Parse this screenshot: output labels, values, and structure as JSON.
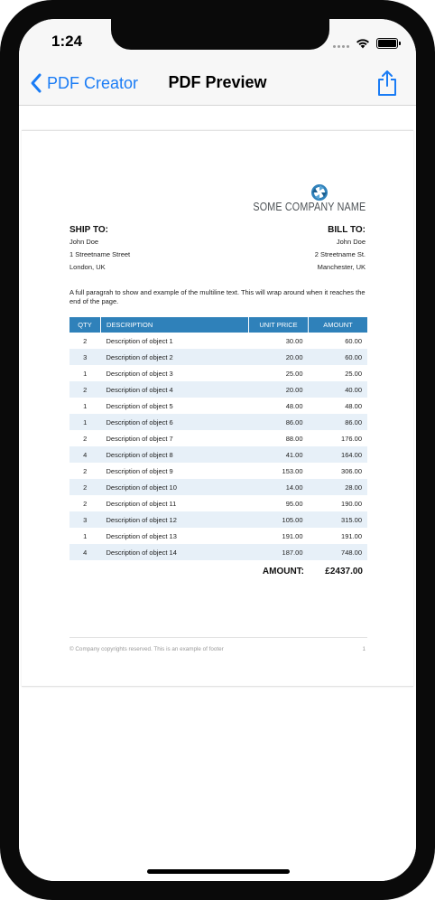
{
  "status_bar": {
    "time": "1:24"
  },
  "nav": {
    "back_label": "PDF Creator",
    "title": "PDF Preview",
    "share_icon": "share-icon"
  },
  "document": {
    "company_name": "SOME COMPANY NAME",
    "ship_to": {
      "heading": "SHIP TO:",
      "lines": [
        "John Doe",
        "1 Streetname Street",
        "London, UK"
      ]
    },
    "bill_to": {
      "heading": "BILL TO:",
      "lines": [
        "John Doe",
        "2 Streetname St.",
        "Manchester, UK"
      ]
    },
    "paragraph": "A full paragrah to show and example of the multiline text. This will wrap around when it reaches the end of the page.",
    "table": {
      "headers": [
        "QTY",
        "DESCRIPTION",
        "UNIT PRICE",
        "AMOUNT"
      ],
      "rows": [
        [
          "2",
          "Description of object 1",
          "30.00",
          "60.00"
        ],
        [
          "3",
          "Description of object 2",
          "20.00",
          "60.00"
        ],
        [
          "1",
          "Description of object 3",
          "25.00",
          "25.00"
        ],
        [
          "2",
          "Description of object 4",
          "20.00",
          "40.00"
        ],
        [
          "1",
          "Description of object 5",
          "48.00",
          "48.00"
        ],
        [
          "1",
          "Description of object 6",
          "86.00",
          "86.00"
        ],
        [
          "2",
          "Description of object 7",
          "88.00",
          "176.00"
        ],
        [
          "4",
          "Description of object 8",
          "41.00",
          "164.00"
        ],
        [
          "2",
          "Description of object 9",
          "153.00",
          "306.00"
        ],
        [
          "2",
          "Description of object 10",
          "14.00",
          "28.00"
        ],
        [
          "2",
          "Description of object 11",
          "95.00",
          "190.00"
        ],
        [
          "3",
          "Description of object 12",
          "105.00",
          "315.00"
        ],
        [
          "1",
          "Description of object 13",
          "191.00",
          "191.00"
        ],
        [
          "4",
          "Description of object 14",
          "187.00",
          "748.00"
        ]
      ]
    },
    "total_label": "AMOUNT:",
    "total_value": "£2437.00",
    "footer_text": "© Company copyrights reserved. This is an example of footer",
    "page_number": "1"
  },
  "colors": {
    "accent": "#1a7cf5",
    "table_header": "#2f81ba",
    "row_alt": "#e7f0f8"
  }
}
